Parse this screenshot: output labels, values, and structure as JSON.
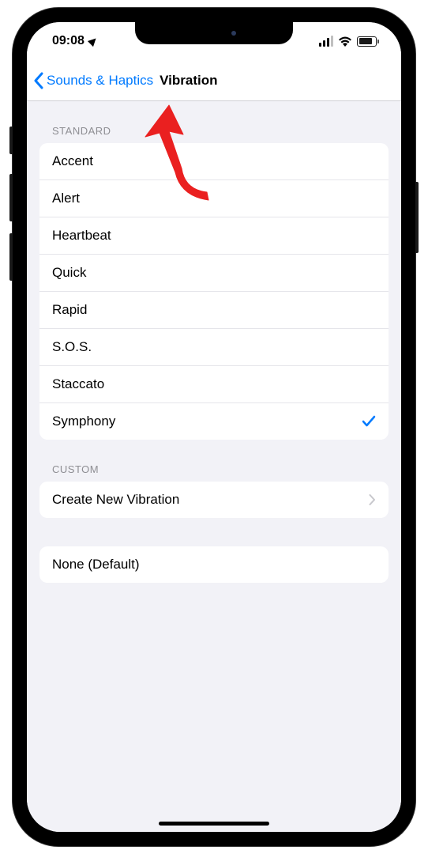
{
  "status": {
    "time": "09:08"
  },
  "nav": {
    "back_label": "Sounds & Haptics",
    "title": "Vibration"
  },
  "sections": {
    "standard": {
      "header": "STANDARD",
      "items": [
        "Accent",
        "Alert",
        "Heartbeat",
        "Quick",
        "Rapid",
        "S.O.S.",
        "Staccato",
        "Symphony"
      ],
      "selected_index": 7
    },
    "custom": {
      "header": "CUSTOM",
      "create_label": "Create New Vibration"
    },
    "none": {
      "label": "None (Default)"
    }
  }
}
